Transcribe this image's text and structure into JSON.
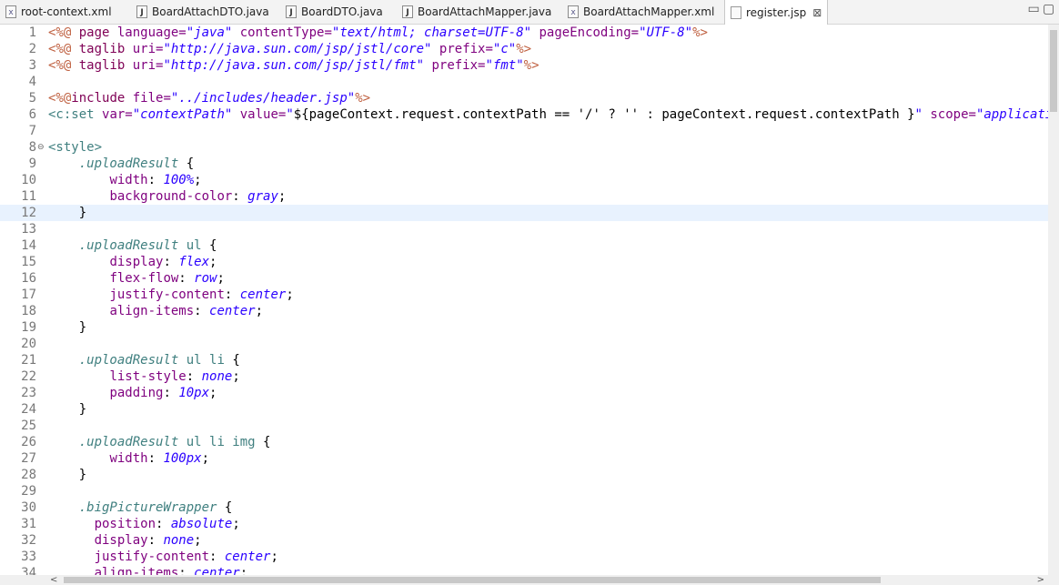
{
  "tabs": [
    {
      "label": "root-context.xml",
      "icon": "xml-file-icon",
      "glyph": "x"
    },
    {
      "label": "BoardAttachDTO.java",
      "icon": "java-file-icon",
      "glyph": "J"
    },
    {
      "label": "BoardDTO.java",
      "icon": "java-file-icon",
      "glyph": "J"
    },
    {
      "label": "BoardAttachMapper.java",
      "icon": "java-file-icon",
      "glyph": "J"
    },
    {
      "label": "BoardAttachMapper.xml",
      "icon": "xml-file-icon",
      "glyph": "x"
    },
    {
      "label": "register.jsp",
      "icon": "jsp-file-icon",
      "glyph": "",
      "close": "⊠"
    }
  ],
  "window_controls": {
    "minimize": "▭",
    "maximize": "▢"
  },
  "lines": [
    {
      "n": "1",
      "segs": [
        [
          "j",
          "<%@ "
        ],
        [
          "k",
          "page "
        ],
        [
          "a",
          "language="
        ],
        [
          "v",
          "\"java\""
        ],
        [
          "b",
          " "
        ],
        [
          "a",
          "contentType="
        ],
        [
          "v",
          "\"text/html; charset=UTF-8\""
        ],
        [
          "b",
          " "
        ],
        [
          "a",
          "pageEncoding="
        ],
        [
          "v",
          "\"UTF-8\""
        ],
        [
          "j",
          "%>"
        ]
      ]
    },
    {
      "n": "2",
      "segs": [
        [
          "j",
          "<%@ "
        ],
        [
          "k",
          "taglib "
        ],
        [
          "a",
          "uri="
        ],
        [
          "v",
          "\"http://java.sun.com/jsp/jstl/core\""
        ],
        [
          "b",
          " "
        ],
        [
          "a",
          "prefix="
        ],
        [
          "v",
          "\"c\""
        ],
        [
          "j",
          "%>"
        ]
      ]
    },
    {
      "n": "3",
      "segs": [
        [
          "j",
          "<%@ "
        ],
        [
          "k",
          "taglib "
        ],
        [
          "a",
          "uri="
        ],
        [
          "v",
          "\"http://java.sun.com/jsp/jstl/fmt\""
        ],
        [
          "b",
          " "
        ],
        [
          "a",
          "prefix="
        ],
        [
          "v",
          "\"fmt\""
        ],
        [
          "j",
          "%>"
        ]
      ]
    },
    {
      "n": "4",
      "segs": []
    },
    {
      "n": "5",
      "segs": [
        [
          "j",
          "<%@"
        ],
        [
          "k",
          "include "
        ],
        [
          "a",
          "file="
        ],
        [
          "v",
          "\"../includes/header.jsp\""
        ],
        [
          "j",
          "%>"
        ]
      ]
    },
    {
      "n": "6",
      "segs": [
        [
          "t",
          "<c:set "
        ],
        [
          "a",
          "var="
        ],
        [
          "v",
          "\"contextPath\""
        ],
        [
          "b",
          " "
        ],
        [
          "a",
          "value="
        ],
        [
          "v",
          "\""
        ],
        [
          "b",
          "${pageContext.request.contextPath == '/' ? '' : pageContext.request.contextPath }"
        ],
        [
          "v",
          "\""
        ],
        [
          "b",
          " "
        ],
        [
          "a",
          "scope="
        ],
        [
          "v",
          "\"application\""
        ],
        [
          "b",
          " "
        ],
        [
          "t",
          "/>"
        ]
      ]
    },
    {
      "n": "7",
      "segs": []
    },
    {
      "n": "8",
      "fold": "⊖",
      "segs": [
        [
          "t",
          "<style>"
        ]
      ]
    },
    {
      "n": "9",
      "segs": [
        [
          "b",
          "    "
        ],
        [
          "sel",
          ".uploadResult"
        ],
        [
          "b",
          " {"
        ]
      ]
    },
    {
      "n": "10",
      "segs": [
        [
          "b",
          "        "
        ],
        [
          "p",
          "width"
        ],
        [
          "b",
          ": "
        ],
        [
          "pv",
          "100%"
        ],
        [
          "b",
          ";"
        ]
      ]
    },
    {
      "n": "11",
      "segs": [
        [
          "b",
          "        "
        ],
        [
          "p",
          "background-color"
        ],
        [
          "b",
          ": "
        ],
        [
          "pv",
          "gray"
        ],
        [
          "b",
          ";"
        ]
      ]
    },
    {
      "n": "12",
      "cur": true,
      "segs": [
        [
          "b",
          "    }"
        ]
      ]
    },
    {
      "n": "13",
      "segs": []
    },
    {
      "n": "14",
      "segs": [
        [
          "b",
          "    "
        ],
        [
          "sel",
          ".uploadResult"
        ],
        [
          "b",
          " "
        ],
        [
          "t",
          "ul"
        ],
        [
          "b",
          " {"
        ]
      ]
    },
    {
      "n": "15",
      "segs": [
        [
          "b",
          "        "
        ],
        [
          "p",
          "display"
        ],
        [
          "b",
          ": "
        ],
        [
          "pv",
          "flex"
        ],
        [
          "b",
          ";"
        ]
      ]
    },
    {
      "n": "16",
      "segs": [
        [
          "b",
          "        "
        ],
        [
          "p",
          "flex-flow"
        ],
        [
          "b",
          ": "
        ],
        [
          "pv",
          "row"
        ],
        [
          "b",
          ";"
        ]
      ]
    },
    {
      "n": "17",
      "segs": [
        [
          "b",
          "        "
        ],
        [
          "p",
          "justify-content"
        ],
        [
          "b",
          ": "
        ],
        [
          "pv",
          "center"
        ],
        [
          "b",
          ";"
        ]
      ]
    },
    {
      "n": "18",
      "segs": [
        [
          "b",
          "        "
        ],
        [
          "p",
          "align-items"
        ],
        [
          "b",
          ": "
        ],
        [
          "pv",
          "center"
        ],
        [
          "b",
          ";"
        ]
      ]
    },
    {
      "n": "19",
      "segs": [
        [
          "b",
          "    }"
        ]
      ]
    },
    {
      "n": "20",
      "segs": []
    },
    {
      "n": "21",
      "segs": [
        [
          "b",
          "    "
        ],
        [
          "sel",
          ".uploadResult"
        ],
        [
          "b",
          " "
        ],
        [
          "t",
          "ul li"
        ],
        [
          "b",
          " {"
        ]
      ]
    },
    {
      "n": "22",
      "segs": [
        [
          "b",
          "        "
        ],
        [
          "p",
          "list-style"
        ],
        [
          "b",
          ": "
        ],
        [
          "pv",
          "none"
        ],
        [
          "b",
          ";"
        ]
      ]
    },
    {
      "n": "23",
      "segs": [
        [
          "b",
          "        "
        ],
        [
          "p",
          "padding"
        ],
        [
          "b",
          ": "
        ],
        [
          "pv",
          "10px"
        ],
        [
          "b",
          ";"
        ]
      ]
    },
    {
      "n": "24",
      "segs": [
        [
          "b",
          "    }"
        ]
      ]
    },
    {
      "n": "25",
      "segs": []
    },
    {
      "n": "26",
      "segs": [
        [
          "b",
          "    "
        ],
        [
          "sel",
          ".uploadResult"
        ],
        [
          "b",
          " "
        ],
        [
          "t",
          "ul li img"
        ],
        [
          "b",
          " {"
        ]
      ]
    },
    {
      "n": "27",
      "segs": [
        [
          "b",
          "        "
        ],
        [
          "p",
          "width"
        ],
        [
          "b",
          ": "
        ],
        [
          "pv",
          "100px"
        ],
        [
          "b",
          ";"
        ]
      ]
    },
    {
      "n": "28",
      "segs": [
        [
          "b",
          "    }"
        ]
      ]
    },
    {
      "n": "29",
      "segs": []
    },
    {
      "n": "30",
      "segs": [
        [
          "b",
          "    "
        ],
        [
          "sel",
          ".bigPictureWrapper"
        ],
        [
          "b",
          " {"
        ]
      ]
    },
    {
      "n": "31",
      "segs": [
        [
          "b",
          "      "
        ],
        [
          "p",
          "position"
        ],
        [
          "b",
          ": "
        ],
        [
          "pv",
          "absolute"
        ],
        [
          "b",
          ";"
        ]
      ]
    },
    {
      "n": "32",
      "segs": [
        [
          "b",
          "      "
        ],
        [
          "p",
          "display"
        ],
        [
          "b",
          ": "
        ],
        [
          "pv",
          "none"
        ],
        [
          "b",
          ";"
        ]
      ]
    },
    {
      "n": "33",
      "segs": [
        [
          "b",
          "      "
        ],
        [
          "p",
          "justify-content"
        ],
        [
          "b",
          ": "
        ],
        [
          "pv",
          "center"
        ],
        [
          "b",
          ";"
        ]
      ]
    },
    {
      "n": "34",
      "segs": [
        [
          "b",
          "      "
        ],
        [
          "p",
          "align-items"
        ],
        [
          "b",
          ": "
        ],
        [
          "pv",
          "center"
        ],
        [
          "b",
          ";"
        ]
      ]
    }
  ]
}
